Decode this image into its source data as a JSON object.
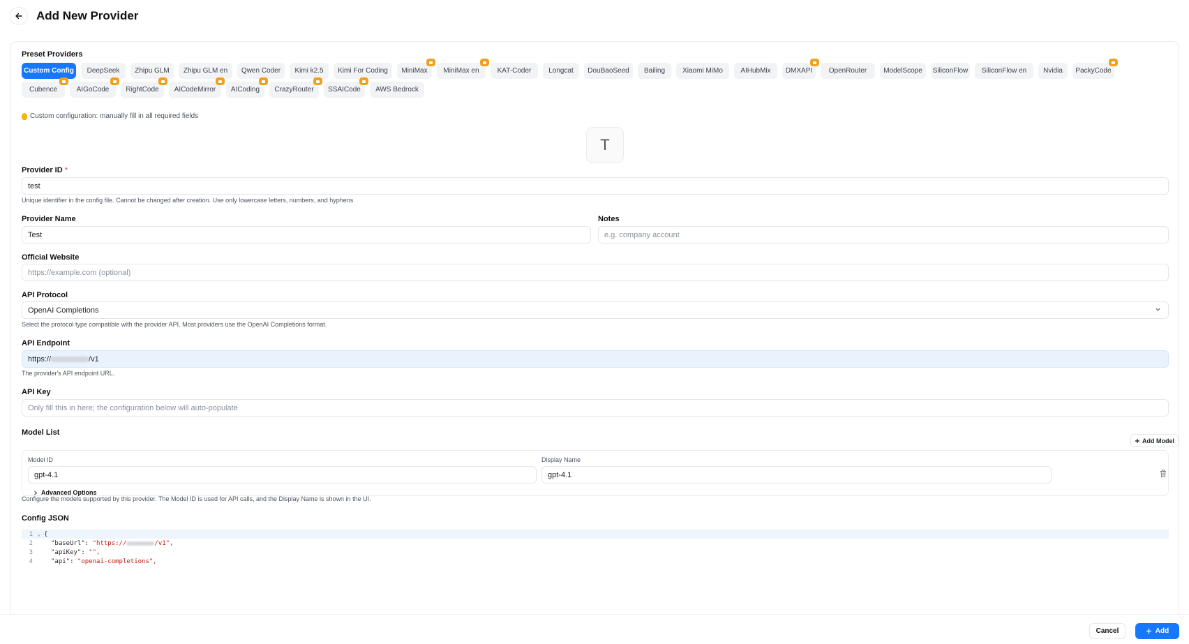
{
  "page": {
    "title": "Add New Provider"
  },
  "presets": {
    "title": "Preset Providers",
    "row1": [
      {
        "label": "Custom Config",
        "active": true,
        "badge": false
      },
      {
        "label": "DeepSeek",
        "badge": false
      },
      {
        "label": "Zhipu GLM",
        "badge": false
      },
      {
        "label": "Zhipu GLM en",
        "badge": false
      },
      {
        "label": "Qwen Coder",
        "badge": false
      },
      {
        "label": "Kimi k2.5",
        "badge": false
      },
      {
        "label": "Kimi For Coding",
        "badge": false
      },
      {
        "label": "MiniMax",
        "badge": true
      },
      {
        "label": "MiniMax en",
        "badge": true
      },
      {
        "label": "KAT-Coder",
        "badge": false
      },
      {
        "label": "Longcat",
        "badge": false
      },
      {
        "label": "DouBaoSeed",
        "badge": false
      },
      {
        "label": "Bailing",
        "badge": false
      },
      {
        "label": "Xiaomi MiMo",
        "badge": false
      },
      {
        "label": "AIHubMix",
        "badge": false
      },
      {
        "label": "DMXAPI",
        "badge": true
      },
      {
        "label": "OpenRouter",
        "badge": false
      },
      {
        "label": "ModelScope",
        "badge": false
      },
      {
        "label": "SiliconFlow",
        "badge": false
      },
      {
        "label": "SiliconFlow en",
        "badge": false
      },
      {
        "label": "Nvidia",
        "badge": false
      },
      {
        "label": "PackyCode",
        "badge": true
      }
    ],
    "row2": [
      {
        "label": "Cubence",
        "badge": true
      },
      {
        "label": "AIGoCode",
        "badge": true
      },
      {
        "label": "RightCode",
        "badge": true
      },
      {
        "label": "AICodeMirror",
        "badge": true
      },
      {
        "label": "AICoding",
        "badge": true
      },
      {
        "label": "CrazyRouter",
        "badge": true
      },
      {
        "label": "SSAICode",
        "badge": true
      },
      {
        "label": "AWS Bedrock",
        "badge": false
      }
    ],
    "hint": "Custom configuration: manually fill in all required fields"
  },
  "icon_preview": {
    "letter": "T"
  },
  "provider_id": {
    "label": "Provider ID",
    "required_mark": "*",
    "value": "test",
    "help": "Unique identifier in the config file. Cannot be changed after creation. Use only lowercase letters, numbers, and hyphens"
  },
  "provider_name": {
    "label": "Provider Name",
    "value": "Test"
  },
  "notes": {
    "label": "Notes",
    "placeholder": "e.g. company account"
  },
  "website": {
    "label": "Official Website",
    "placeholder": "https://example.com (optional)"
  },
  "protocol": {
    "label": "API Protocol",
    "value": "OpenAI Completions",
    "help": "Select the protocol type compatible with the provider API. Most providers use the OpenAI Completions format."
  },
  "endpoint": {
    "label": "API Endpoint",
    "value_prefix": "https://",
    "value_suffix": "/v1",
    "help": "The provider's API endpoint URL."
  },
  "api_key": {
    "label": "API Key",
    "placeholder": "Only fill this in here; the configuration below will auto-populate"
  },
  "models": {
    "title": "Model List",
    "add_label": "Add Model",
    "id_label": "Model ID",
    "name_label": "Display Name",
    "rows": [
      {
        "id": "gpt-4.1",
        "name": "gpt-4.1"
      }
    ],
    "advanced_label": "Advanced Options",
    "help": "Configure the models supported by this provider. The Model ID is used for API calls, and the Display Name is shown in the UI."
  },
  "config_json": {
    "title": "Config JSON",
    "lines": [
      {
        "n": "1",
        "text": "{"
      },
      {
        "n": "2",
        "key": "\"baseUrl\"",
        "val_prefix": "\"https://",
        "val_suffix": "/v1\","
      },
      {
        "n": "3",
        "key": "\"apiKey\"",
        "val": "\"\","
      },
      {
        "n": "4",
        "key": "\"api\"",
        "val": "\"openai-completions\","
      }
    ]
  },
  "footer": {
    "cancel": "Cancel",
    "add": "Add"
  },
  "colors": {
    "accent": "#1677ff",
    "badge": "#f0a01e",
    "string": "#c41a16"
  }
}
